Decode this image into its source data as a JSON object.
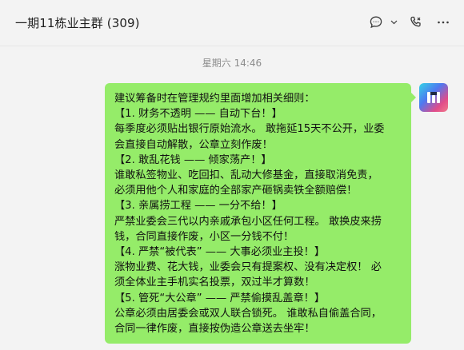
{
  "header": {
    "title": "一期11栋业主群 (309)",
    "icons": [
      "chat-bubble-icon",
      "chevron-down-icon",
      "call-icon",
      "more-icon"
    ]
  },
  "timestamp": "星期六 14:46",
  "message": {
    "sender": "self",
    "lines": [
      "建议筹备时在管理规约里面增加相关细则：",
      "【1. 财务不透明 —— 自动下台！】",
      "每季度必须贴出银行原始流水。 敢拖延15天不公开，业委",
      "会直接自动解散，公章立刻作废！",
      "【2. 敢乱花钱 —— 倾家荡产！】",
      "谁敢私签物业、吃回扣、乱动大修基金，直接取消免责，",
      "必须用他个人和家庭的全部家产砸锅卖铁全额赔偿！",
      "【3. 亲属捞工程 —— 一分不给！】",
      "严禁业委会三代以内亲戚承包小区任何工程。 敢换皮来捞",
      "钱，合同直接作废，小区一分钱不付！",
      "【4. 严禁“被代表” —— 大事必须业主投！】",
      "涨物业费、花大钱，业委会只有提案权、没有决定权！ 必",
      "须全体业主手机实名投票，双过半才算数！",
      "【5. 管死“大公章” —— 严禁偷摸乱盖章！】",
      "公章必须由居委会或双人联合锁死。 谁敢私自偷盖合同，",
      "合同一律作废，直接按伪造公章送去坐牢！"
    ]
  },
  "colors": {
    "bubble": "#95ec69",
    "background": "#f3f3f3",
    "timestamp_text": "#8c8c8c"
  }
}
